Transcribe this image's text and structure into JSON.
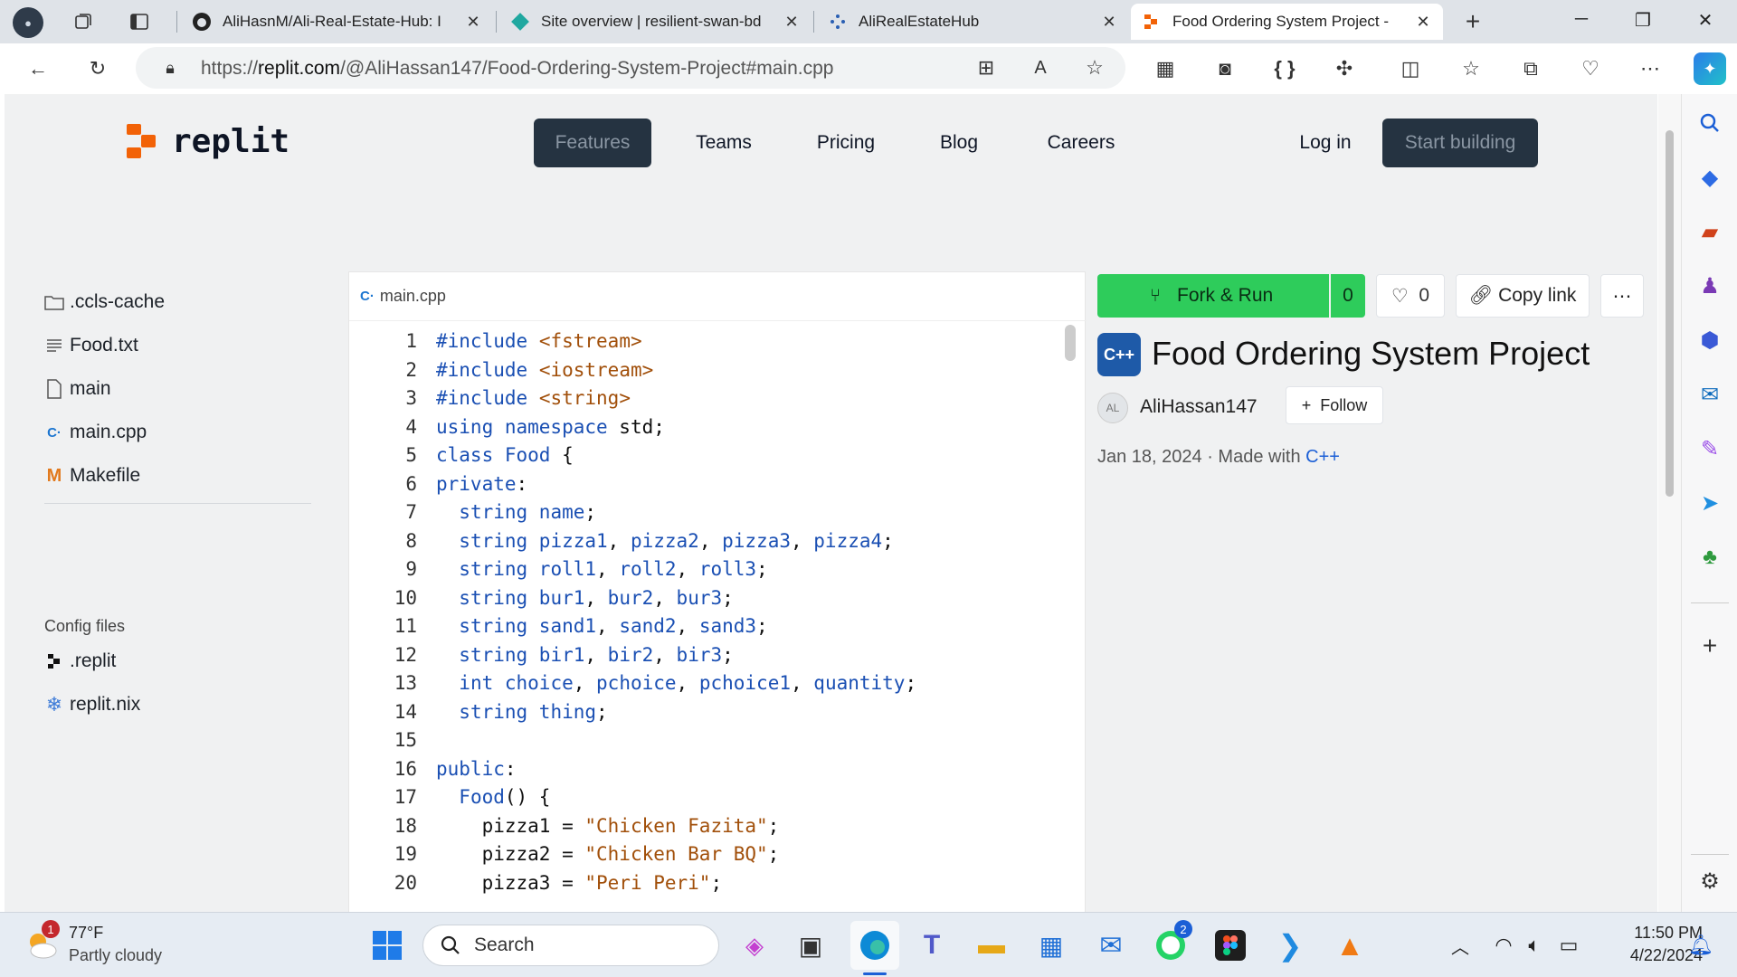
{
  "browser": {
    "tabs": [
      {
        "label": "AliHasnM/Ali-Real-Estate-Hub: I"
      },
      {
        "label": "Site overview | resilient-swan-bd"
      },
      {
        "label": "AliRealEstateHub"
      },
      {
        "label": "Food Ordering System Project -"
      }
    ],
    "url_prefix": "https://",
    "url_host": "replit.com",
    "url_path": "/@AliHassan147/Food-Ordering-System-Project#main.cpp"
  },
  "nav": {
    "logo": "replit",
    "features": "Features",
    "teams": "Teams",
    "pricing": "Pricing",
    "blog": "Blog",
    "careers": "Careers",
    "login": "Log in",
    "start": "Start building"
  },
  "files": {
    "items": [
      {
        "name": ".ccls-cache"
      },
      {
        "name": "Food.txt"
      },
      {
        "name": "main"
      },
      {
        "name": "main.cpp"
      },
      {
        "name": "Makefile"
      }
    ],
    "config_title": "Config files",
    "config_items": [
      {
        "name": ".replit"
      },
      {
        "name": "replit.nix"
      }
    ]
  },
  "editor": {
    "filename": "main.cpp",
    "lines": [
      "1",
      "2",
      "3",
      "4",
      "5",
      "6",
      "7",
      "8",
      "9",
      "10",
      "11",
      "12",
      "13",
      "14",
      "15",
      "16",
      "17",
      "18",
      "19",
      "20"
    ]
  },
  "repl": {
    "fork_run": "Fork & Run",
    "fork_count": "0",
    "likes": "0",
    "copy_link": "Copy link",
    "more": "⋯",
    "title": "Food Ordering System Project",
    "avatar_initials": "AL",
    "author": "AliHassan147",
    "follow": "Follow",
    "date": "Jan 18, 2024 · Made with ",
    "lang": "C++"
  },
  "taskbar": {
    "temp": "77°F",
    "weather": "Partly cloudy",
    "search": "Search",
    "time": "11:50 PM",
    "date": "4/22/2024",
    "weather_badge": "1",
    "whatsapp_badge": "2"
  }
}
